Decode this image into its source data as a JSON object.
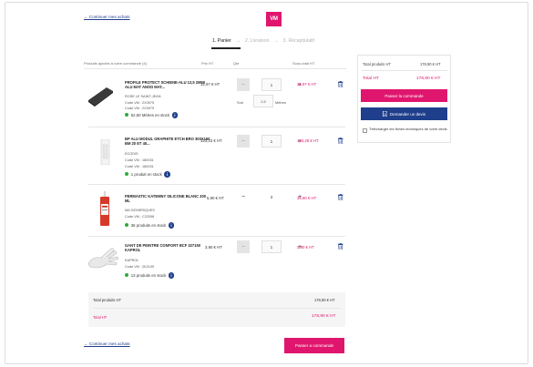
{
  "nav": {
    "continue_label": "← Continuer mes achats",
    "logo_text": "VM"
  },
  "steps": [
    {
      "label": "1. Panier",
      "active": true
    },
    {
      "label": "2. Livraison",
      "active": false
    },
    {
      "label": "3. Récapitulatif",
      "active": false
    }
  ],
  "step_arrow": "→",
  "table": {
    "headers": {
      "product": "Produits ajoutés à votre commande (4)",
      "unit_price": "Prix HT",
      "qty": "Qté",
      "total": "Sous-total HT"
    },
    "items": [
      {
        "name": "PROFILE PROTECT SCHIENE-ALU 12,5 2M50 ALU MAT ANOD MAT...",
        "brand": "Rose Le Saint-Jean",
        "codes": [
          "Code VM : 2X3975",
          "Code VM : 2X3975"
        ],
        "stock": "52,50 Mètres en stock",
        "unit_price": "12,97 € HT",
        "qty": "1",
        "sub_label": "Soit",
        "sub_value": "2,5",
        "sub_unit": "Mètres",
        "total": "31,97 € HT"
      },
      {
        "name": "BP ALU MODUL GRAPHITE ETCH BRO 300X150 BM 20 et 40...",
        "brand": "Ecodis",
        "codes": [
          "Code VM : 180031",
          "Code VM : 180031"
        ],
        "stock": "1 produit en stock",
        "unit_price": "123,23 € HT",
        "qty": "1",
        "total": "123,28 € HT"
      },
      {
        "name": "PERMASTIC KATEMNY SILICONE BLANC 300 ML",
        "brand": "MA GENIERIQUES",
        "codes": [
          "Code VM : C22098"
        ],
        "stock": "36 produits en stock",
        "unit_price": "5,90 € HT",
        "qty": "3",
        "total": "34,90 € HT"
      },
      {
        "name": "GANT DE PEINTRE CONFORT BCF 327150 KAPROL",
        "brand": "Kaprol",
        "codes": [
          "Code VM : 2K2109"
        ],
        "stock": "13 produits en stock",
        "unit_price": "3,90 € HT",
        "qty": "1",
        "total": "3,90 € HT"
      }
    ]
  },
  "summary_panel": {
    "subtotal_label": "Total produits HT",
    "subtotal_value": "178,90 € HT",
    "total_label": "Total HT",
    "total_value": "178,90 € HT",
    "order_button": "Passer la commande",
    "quote_button": "Demander un devis",
    "tech_sheets": "Télécharger les fiches techniques de votre devis"
  },
  "footer_totals": {
    "subtotal_label": "Total produits HT",
    "subtotal_value": "178,90 € HT",
    "total_label": "Total HT",
    "total_value": "178,90 € HT"
  },
  "bottom": {
    "continue_label": "← Continuer mes achats",
    "order_button": "Passer a commande"
  },
  "colors": {
    "accent": "#e0166e",
    "primary": "#1f3f8c",
    "stock_green": "#2eaa3c"
  },
  "icons": [
    "logo",
    "trash-icon",
    "info-icon",
    "document-icon",
    "checkbox"
  ]
}
